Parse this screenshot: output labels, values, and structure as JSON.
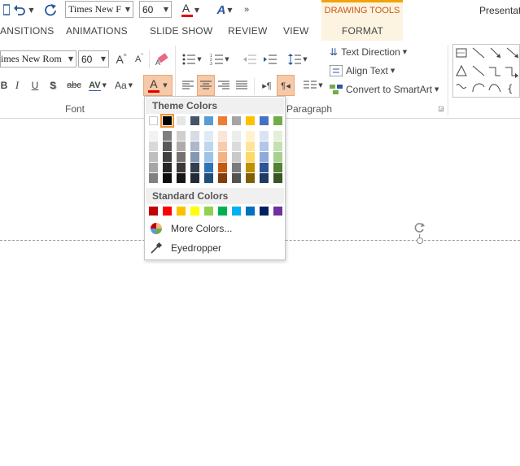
{
  "qat": {
    "font_name": "Times New F",
    "font_size": "60",
    "title": "Presentat"
  },
  "tabs": {
    "transitions": "ANSITIONS",
    "animations": "ANIMATIONS",
    "slideshow": "SLIDE SHOW",
    "review": "REVIEW",
    "view": "VIEW",
    "contextual_group": "DRAWING TOOLS",
    "format": "FORMAT"
  },
  "ribbon": {
    "font_name": "imes New Rom",
    "font_size": "60",
    "grow_font": "A",
    "shrink_font": "A",
    "bold": "B",
    "italic": "I",
    "underline": "U",
    "shadow": "S",
    "strike": "abc",
    "spacing": "AV",
    "change_case": "Aa",
    "font_color": "A",
    "font_group_label": "Font",
    "paragraph_group_label": "Paragraph",
    "text_direction": "Text Direction",
    "align_text": "Align Text",
    "convert_smartart": "Convert to SmartArt"
  },
  "font_color_menu": {
    "theme_header": "Theme Colors",
    "standard_header": "Standard Colors",
    "more_colors": "More Colors...",
    "eyedropper": "Eyedropper",
    "theme_top": [
      "#ffffff",
      "#000000",
      "#e7e6e6",
      "#44546a",
      "#5b9bd5",
      "#ed7d31",
      "#a5a5a5",
      "#ffc000",
      "#4472c4",
      "#70ad47"
    ],
    "theme_shades": [
      [
        "#f2f2f2",
        "#d9d9d9",
        "#bfbfbf",
        "#a6a6a6",
        "#808080"
      ],
      [
        "#7f7f7f",
        "#595959",
        "#404040",
        "#262626",
        "#0d0d0d"
      ],
      [
        "#d0cece",
        "#aeabab",
        "#757171",
        "#3a3838",
        "#171616"
      ],
      [
        "#d6dce4",
        "#adb9ca",
        "#8497b0",
        "#333f4f",
        "#222a35"
      ],
      [
        "#deebf6",
        "#bdd7ee",
        "#9dc3e6",
        "#2e75b5",
        "#1f4e79"
      ],
      [
        "#fbe5d5",
        "#f7cbac",
        "#f4b183",
        "#c55a11",
        "#833c0b"
      ],
      [
        "#ededed",
        "#dbdbdb",
        "#c9c9c9",
        "#7b7b7b",
        "#525252"
      ],
      [
        "#fff2cc",
        "#fee599",
        "#ffd965",
        "#bf9000",
        "#7f6000"
      ],
      [
        "#dae3f3",
        "#b4c6e7",
        "#8eaadb",
        "#2f5496",
        "#1f3864"
      ],
      [
        "#e2efd9",
        "#c5e0b3",
        "#a8d08d",
        "#538135",
        "#375623"
      ]
    ],
    "standard": [
      "#c00000",
      "#ff0000",
      "#ffc000",
      "#ffff00",
      "#92d050",
      "#00b050",
      "#00b0f0",
      "#0070c0",
      "#002060",
      "#7030a0"
    ]
  }
}
